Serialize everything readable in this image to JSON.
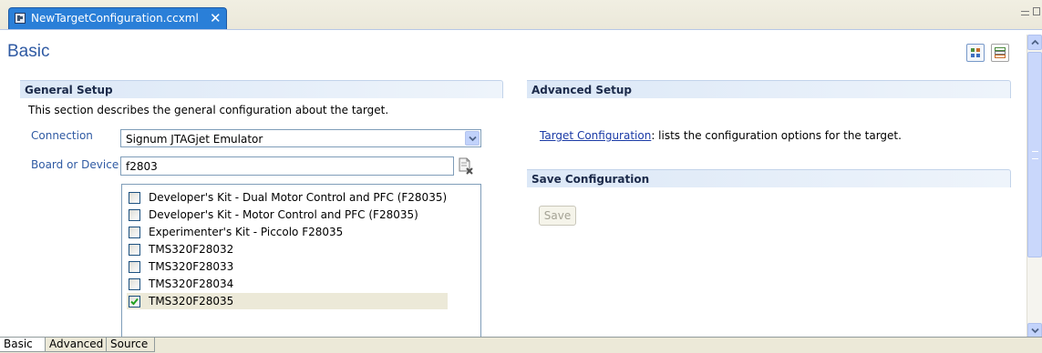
{
  "editor_tab": {
    "title": "NewTargetConfiguration.ccxml",
    "close_glyph": "✕"
  },
  "page": {
    "title": "Basic"
  },
  "general_setup": {
    "title": "General Setup",
    "description": "This section describes the general configuration about the target.",
    "connection_label": "Connection",
    "connection_value": "Signum JTAGjet Emulator",
    "board_label": "Board or Device",
    "board_filter_value": "f2803",
    "devices": [
      {
        "label": "Developer's Kit - Dual Motor Control and PFC (F28035)",
        "checked": false
      },
      {
        "label": "Developer's Kit - Motor Control and PFC (F28035)",
        "checked": false
      },
      {
        "label": "Experimenter's Kit - Piccolo F28035",
        "checked": false
      },
      {
        "label": "TMS320F28032",
        "checked": false
      },
      {
        "label": "TMS320F28033",
        "checked": false
      },
      {
        "label": "TMS320F28034",
        "checked": false
      },
      {
        "label": "TMS320F28035",
        "checked": true
      }
    ]
  },
  "advanced_setup": {
    "title": "Advanced Setup",
    "link_text": "Target Configuration",
    "link_suffix": ": lists the configuration options for the target."
  },
  "save_configuration": {
    "title": "Save Configuration",
    "save_label": "Save"
  },
  "bottom_tabs": [
    {
      "label": "Basic",
      "active": true
    },
    {
      "label": "Advanced",
      "active": false
    },
    {
      "label": "Source",
      "active": false
    }
  ],
  "colors": {
    "tab_active": "#2a7fd8",
    "section_title": "#2f5aa3",
    "link": "#1a3aa6",
    "check": "#21a121"
  }
}
